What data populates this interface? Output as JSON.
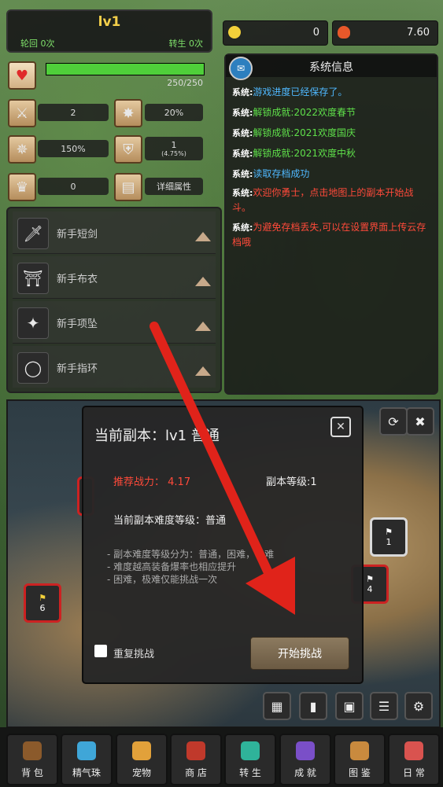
{
  "header": {
    "level": "lv1",
    "reincarnation": "轮回 0次",
    "rebirth": "转生 0次"
  },
  "resources": {
    "gold": "0",
    "fire": "7.60"
  },
  "hp": {
    "text": "250/250",
    "fill_percent": 100
  },
  "stats": {
    "attack": "2",
    "crit": "20%",
    "crit_damage": "150%",
    "defense": "1",
    "defense_sub": "(4.75%)",
    "luck": "0",
    "detail_label": "详细属性"
  },
  "equipment": [
    {
      "name": "新手短剑",
      "icon": "sword-icon"
    },
    {
      "name": "新手布衣",
      "icon": "armor-icon"
    },
    {
      "name": "新手项坠",
      "icon": "pendant-icon"
    },
    {
      "name": "新手指环",
      "icon": "ring-icon"
    }
  ],
  "system": {
    "title": "系统信息",
    "prefix": "系统:",
    "messages": [
      {
        "text": "游戏进度已经保存了。",
        "color": "#4fb8ff"
      },
      {
        "text": "解锁成就:2022欢度春节",
        "color": "#5fe04a"
      },
      {
        "text": "解锁成就:2021欢度国庆",
        "color": "#5fe04a"
      },
      {
        "text": "解锁成就:2021欢度中秋",
        "color": "#5fe04a"
      },
      {
        "text": "读取存档成功",
        "color": "#4fb8ff"
      },
      {
        "text": "欢迎你勇士，点击地图上的副本开始战斗。",
        "color": "#ff4a3a"
      },
      {
        "text": "为避免存档丢失,可以在设置界面上传云存档哦",
        "color": "#ff4a3a"
      }
    ]
  },
  "map": {
    "flags": [
      {
        "label": "1"
      },
      {
        "label": "4"
      },
      {
        "label": "6"
      }
    ]
  },
  "dialog": {
    "title": "当前副本：lv1 普通",
    "power_label": "推荐战力：",
    "power_value": "4.17",
    "level_label": "副本等级:",
    "level_value": "1",
    "difficulty": "当前副本难度等级：普通",
    "notes": [
      "- 副本难度等级分为：普通，困难，极难",
      "- 难度越高装备爆率也相应提升",
      "- 困难，极难仅能挑战一次"
    ],
    "repeat_label": "重复挑战",
    "start_label": "开始挑战"
  },
  "nav": [
    {
      "label": "背 包",
      "icon": "bag-icon",
      "color": "#8b5a2b"
    },
    {
      "label": "精气珠",
      "icon": "orb-icon",
      "color": "#3fa6d8"
    },
    {
      "label": "宠物",
      "icon": "pet-icon",
      "color": "#e2a13a"
    },
    {
      "label": "商 店",
      "icon": "shop-icon",
      "color": "#c0392b"
    },
    {
      "label": "转 生",
      "icon": "rebirth-icon",
      "color": "#2fb39a"
    },
    {
      "label": "成 就",
      "icon": "achievement-icon",
      "color": "#7a4fc8"
    },
    {
      "label": "图 鉴",
      "icon": "codex-icon",
      "color": "#c98a3e"
    },
    {
      "label": "日 常",
      "icon": "daily-icon",
      "color": "#d9534f"
    }
  ]
}
